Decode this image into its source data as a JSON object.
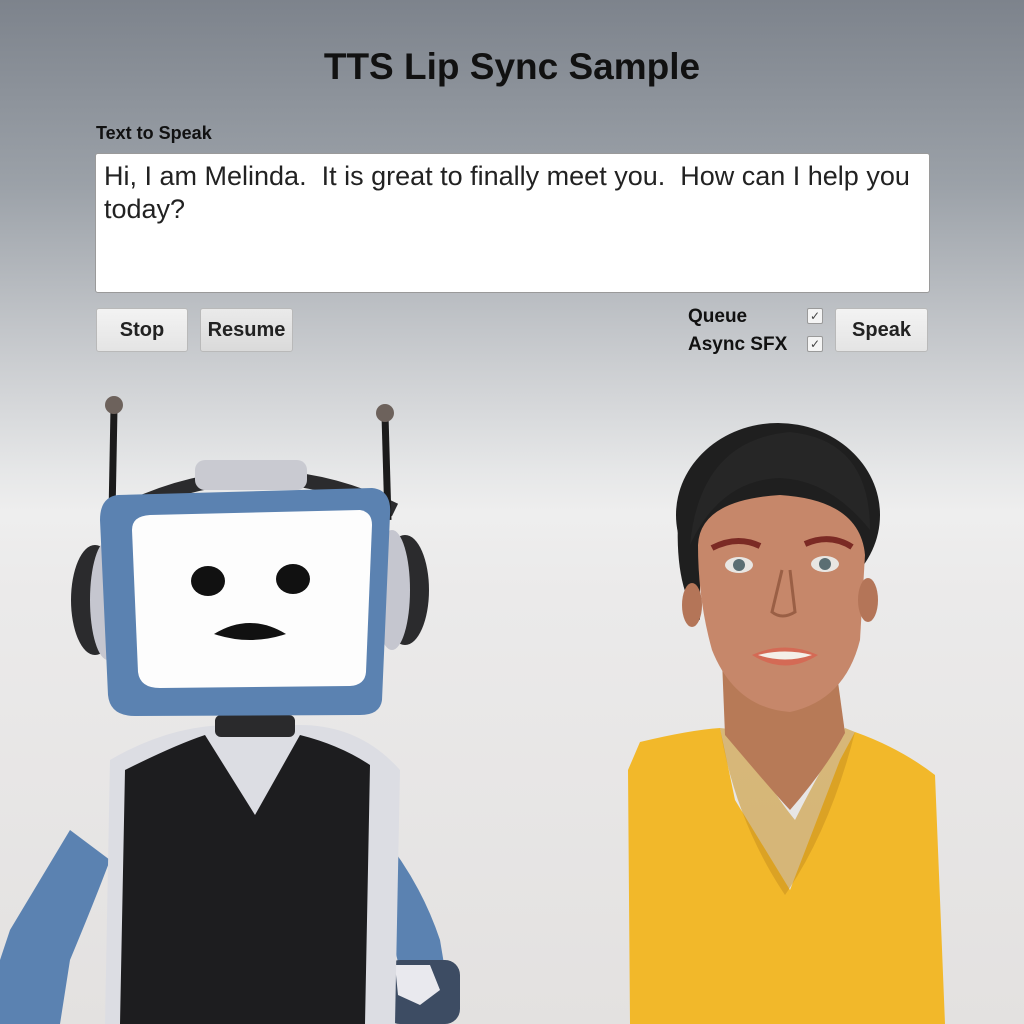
{
  "window": {
    "title": "TTS Lip Sync Sample"
  },
  "form": {
    "text_label": "Text to Speak",
    "text_value": "Hi, I am Melinda.  It is great to finally meet you.  How can I help you today?"
  },
  "controls": {
    "stop_label": "Stop",
    "resume_label": "Resume",
    "speak_label": "Speak",
    "queue_label": "Queue",
    "queue_checked": true,
    "async_label": "Async SFX",
    "async_checked": true,
    "check_glyph": "✓"
  },
  "scene": {
    "characters": [
      "robot-avatar",
      "human-avatar"
    ],
    "colors": {
      "robot_frame": "#5b82b1",
      "robot_vest": "#1d1d1f",
      "human_shirt": "#f2b82a",
      "human_skin": "#b77a57",
      "human_hair": "#1f1f1f"
    }
  }
}
